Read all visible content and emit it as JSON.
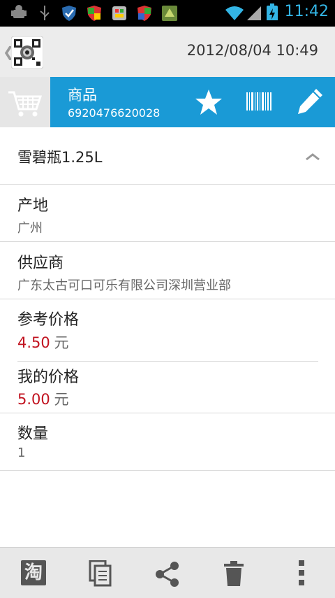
{
  "status_bar": {
    "time": "11:42",
    "icons": [
      "android-debug-icon",
      "usb-icon",
      "shield-icon",
      "shield-color-icon",
      "app-icon-1",
      "shield-color-icon-2",
      "app-icon-2",
      "wifi-icon",
      "signal-icon",
      "battery-charging-icon"
    ]
  },
  "header": {
    "date": "2012/08/04 10:49"
  },
  "product": {
    "type_label": "商品",
    "code": "6920476620028",
    "name": "雪碧瓶1.25L"
  },
  "fields": {
    "origin": {
      "label": "产地",
      "value": "广州"
    },
    "supplier": {
      "label": "供应商",
      "value": "广东太古可口可乐有限公司深圳营业部"
    },
    "ref_price": {
      "label": "参考价格",
      "value": "4.50",
      "unit": "元"
    },
    "my_price": {
      "label": "我的价格",
      "value": "5.00",
      "unit": "元"
    },
    "quantity": {
      "label": "数量",
      "value": "1"
    }
  },
  "colors": {
    "accent": "#1a9ad6",
    "price": "#c1121f",
    "status_time": "#33b5e5"
  },
  "bottom_bar": {
    "icons": [
      "taobao-icon",
      "copy-icon",
      "share-icon",
      "trash-icon",
      "overflow-menu-icon"
    ],
    "taobao_char": "淘"
  }
}
